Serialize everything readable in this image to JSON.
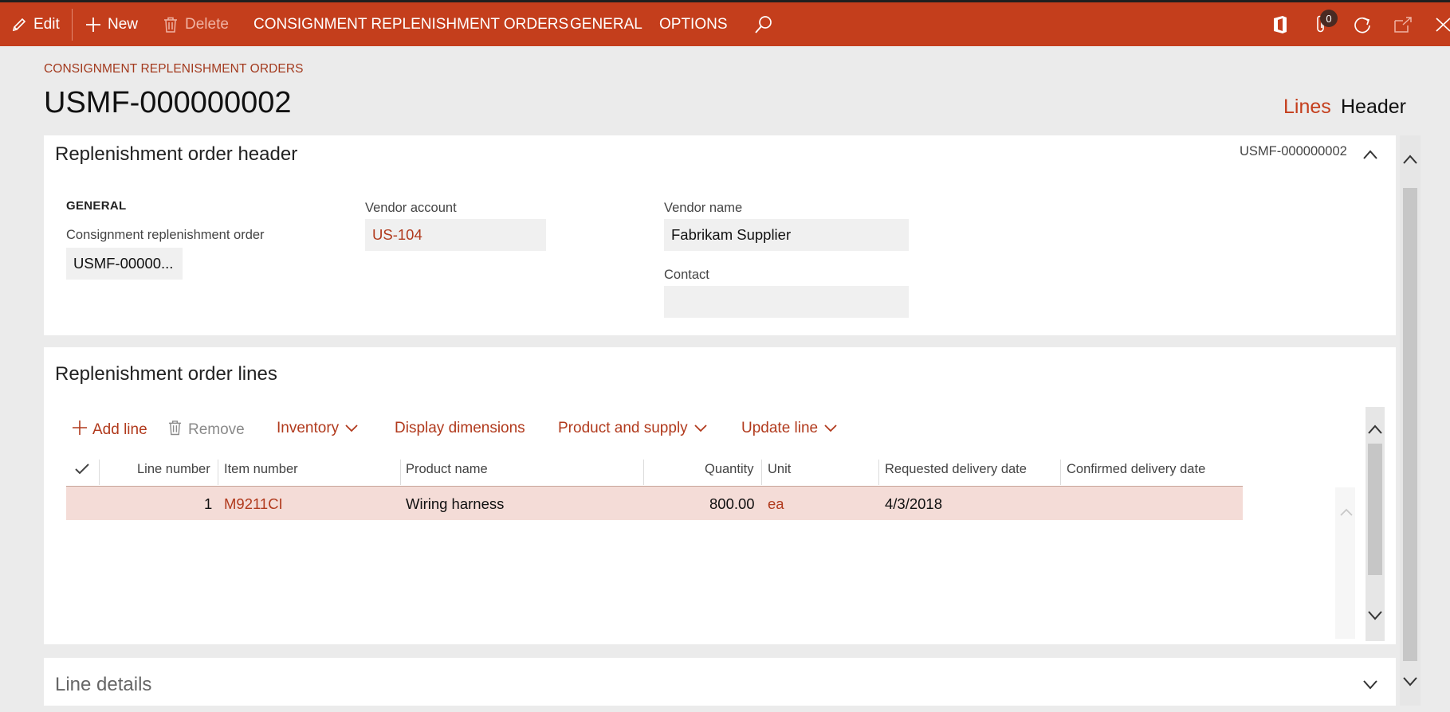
{
  "toolbar": {
    "edit_label": "Edit",
    "new_label": "New",
    "delete_label": "Delete",
    "menu_consignment": "CONSIGNMENT REPLENISHMENT ORDERS",
    "menu_general": "GENERAL",
    "menu_options": "OPTIONS",
    "attachments_count": "0",
    "icons": [
      "edit-icon",
      "plus-icon",
      "trash-icon",
      "search-icon",
      "office-icon",
      "attachment-icon",
      "refresh-icon",
      "open-new-window-icon",
      "close-icon"
    ]
  },
  "page": {
    "breadcrumb": "CONSIGNMENT REPLENISHMENT ORDERS",
    "title": "USMF-000000002",
    "view_lines": "Lines",
    "view_header": "Header"
  },
  "header_section": {
    "title": "Replenishment order header",
    "summary": "USMF-000000002",
    "group_general": "GENERAL",
    "order_label": "Consignment replenishment order",
    "order_value": "USMF-00000...",
    "vendor_account_label": "Vendor account",
    "vendor_account_value": "US-104",
    "vendor_name_label": "Vendor name",
    "vendor_name_value": "Fabrikam Supplier",
    "contact_label": "Contact",
    "contact_value": ""
  },
  "lines_section": {
    "title": "Replenishment order lines",
    "toolbar": {
      "add_line": "Add line",
      "remove": "Remove",
      "inventory": "Inventory",
      "display_dimensions": "Display dimensions",
      "product_and_supply": "Product and supply",
      "update_line": "Update line"
    },
    "columns": [
      "Line number",
      "Item number",
      "Product name",
      "Quantity",
      "Unit",
      "Requested delivery date",
      "Confirmed delivery date"
    ],
    "rows": [
      {
        "line_number": "1",
        "item_number": "M9211CI",
        "product_name": "Wiring harness",
        "quantity": "800.00",
        "unit": "ea",
        "requested_delivery_date": "4/3/2018",
        "confirmed_delivery_date": ""
      }
    ]
  },
  "details_section": {
    "title": "Line details"
  },
  "colors": {
    "accent": "#c43e1c",
    "link": "#b13a1d",
    "selected_row": "#f4dcd7"
  }
}
